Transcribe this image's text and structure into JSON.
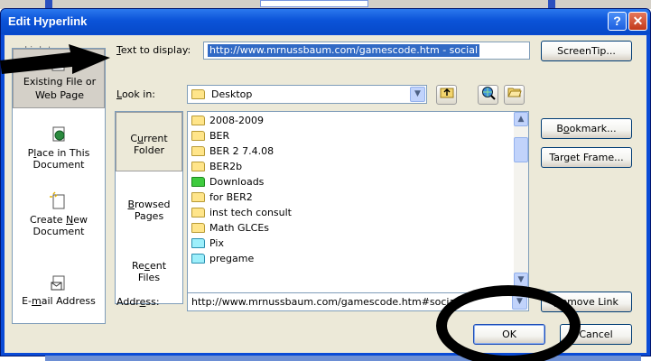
{
  "dialog": {
    "title": "Edit Hyperlink",
    "help_label": "?",
    "close_label": "✕"
  },
  "text_to_display": {
    "label": "Text to display:",
    "value": "http://www.mrnussbaum.com/gamescode.htm - social"
  },
  "screentip_button": "ScreenTip...",
  "link_to": {
    "partial_label": "Link to:",
    "items": [
      {
        "label_line1": "Existing File or",
        "label_line2": "Web Page",
        "icon": "existing-file-icon",
        "selected": true
      },
      {
        "label_line1": "Place in This",
        "label_line2": "Document",
        "icon": "place-in-document-icon",
        "selected": false
      },
      {
        "label_line1": "Create New",
        "label_line2": "Document",
        "icon": "create-new-document-icon",
        "selected": false
      },
      {
        "label_line1": "E-mail Address",
        "label_line2": "",
        "icon": "email-address-icon",
        "selected": false
      }
    ]
  },
  "look_in": {
    "label": "Look in:",
    "value": "Desktop"
  },
  "places": [
    {
      "line1": "Current",
      "line2": "Folder",
      "selected": true
    },
    {
      "line1": "Browsed",
      "line2": "Pages",
      "selected": false
    },
    {
      "line1": "Recent",
      "line2": "Files",
      "selected": false
    }
  ],
  "files": [
    {
      "name": "2008-2009",
      "kind": "folder"
    },
    {
      "name": "BER",
      "kind": "folder"
    },
    {
      "name": "BER 2 7.4.08",
      "kind": "folder"
    },
    {
      "name": "BER2b",
      "kind": "folder"
    },
    {
      "name": "Downloads",
      "kind": "folder-green"
    },
    {
      "name": "for BER2",
      "kind": "folder"
    },
    {
      "name": "inst tech consult",
      "kind": "folder"
    },
    {
      "name": "Math GLCEs",
      "kind": "folder"
    },
    {
      "name": "Pix",
      "kind": "folder-cyan"
    },
    {
      "name": "pregame",
      "kind": "folder-cyan"
    }
  ],
  "right_buttons": {
    "bookmark": "Bookmark...",
    "target_frame": "Target Frame...",
    "remove_link": "Remove Link"
  },
  "address": {
    "label": "Address:",
    "value": "http://www.mrnussbaum.com/gamescode.htm#social"
  },
  "footer": {
    "ok": "OK",
    "cancel": "Cancel"
  },
  "colors": {
    "title_bar": "#0b53d8",
    "selection": "#316ac5",
    "annotation": "#000000"
  }
}
